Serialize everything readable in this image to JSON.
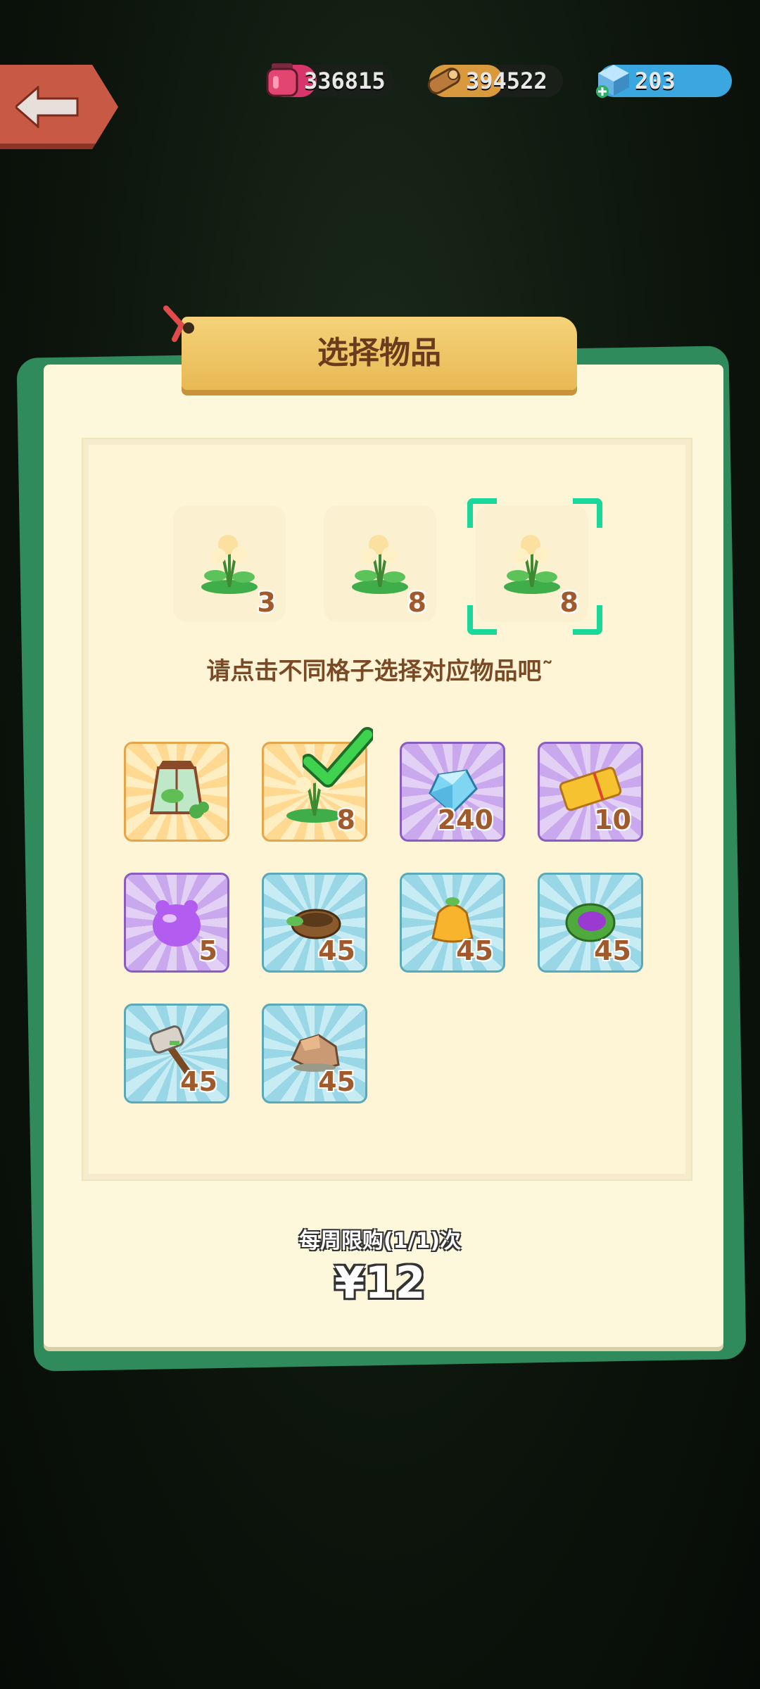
{
  "resources": {
    "potion": "336815",
    "wood": "394522",
    "gems": "203"
  },
  "dialog": {
    "title": "选择物品",
    "hint": "请点击不同格子选择对应物品吧˜",
    "limit": "每周限购(1/1)次",
    "price": "¥12"
  },
  "slots": [
    {
      "icon": "lily-plant-icon",
      "count": "3"
    },
    {
      "icon": "lily-plant-icon",
      "count": "8"
    },
    {
      "icon": "lily-plant-icon",
      "count": "8"
    }
  ],
  "items": [
    {
      "icon": "lantern-terrarium-icon",
      "count": "",
      "rarity": "orange"
    },
    {
      "icon": "lily-plant-icon",
      "count": "8",
      "rarity": "orange"
    },
    {
      "icon": "diamond-icon",
      "count": "240",
      "rarity": "purple"
    },
    {
      "icon": "golden-ticket-icon",
      "count": "10",
      "rarity": "purple"
    },
    {
      "icon": "purple-slime-icon",
      "count": "5",
      "rarity": "purple"
    },
    {
      "icon": "nest-icon",
      "count": "45",
      "rarity": "blue"
    },
    {
      "icon": "orange-bag-icon",
      "count": "45",
      "rarity": "blue"
    },
    {
      "icon": "purple-leaf-pouch-icon",
      "count": "45",
      "rarity": "blue"
    },
    {
      "icon": "hammer-icon",
      "count": "45",
      "rarity": "blue"
    },
    {
      "icon": "stone-icon",
      "count": "45",
      "rarity": "blue"
    }
  ]
}
